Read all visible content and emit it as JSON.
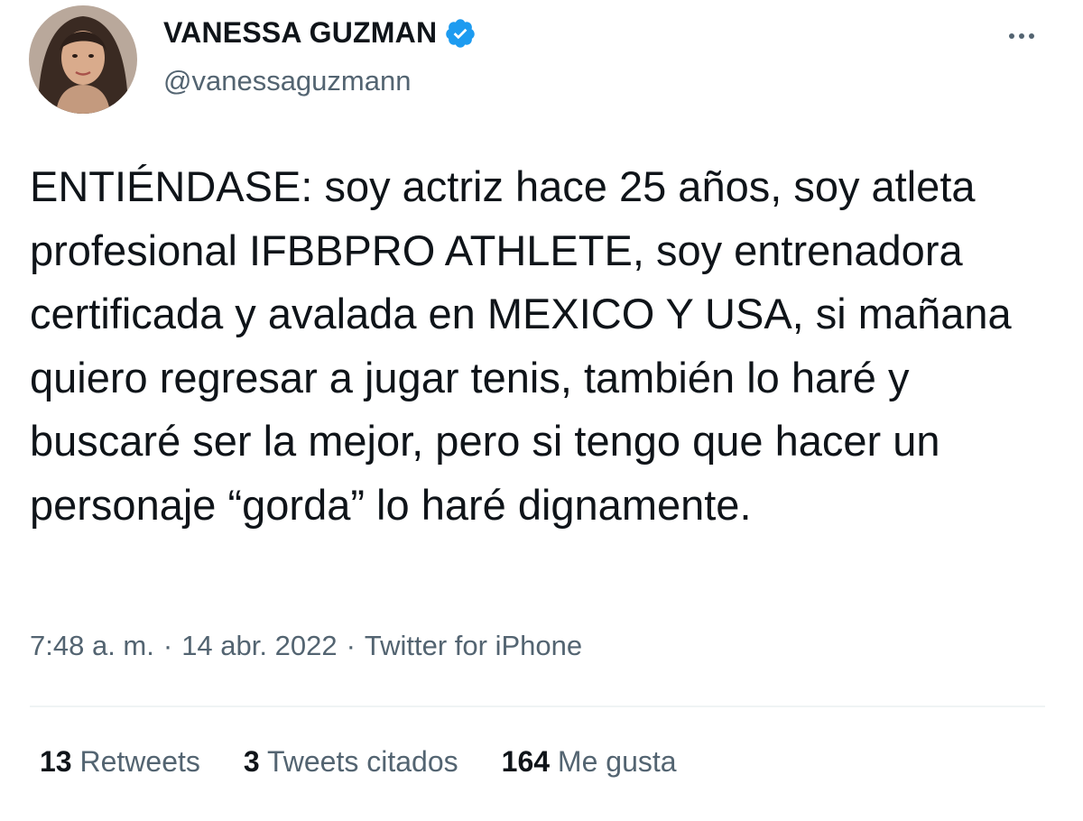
{
  "header": {
    "display_name": "VANESSA GUZMAN",
    "handle": "@vanessaguzmann",
    "avatar_icon": "profile-photo",
    "verified_icon": "verified-badge-icon",
    "more_icon": "more-options-icon"
  },
  "tweet": {
    "text": "ENTIÉNDASE: soy actriz hace 25 años, soy atleta profesional IFBBPRO ATHLETE, soy entrenadora certificada y avalada en MEXICO Y USA, si mañana quiero regresar a jugar tenis, también lo haré y buscaré ser la mejor, pero si tengo que hacer un personaje “gorda” lo haré dignamente.",
    "time": "7:48 a. m.",
    "date": "14 abr. 2022",
    "separator": "·",
    "source": "Twitter for iPhone"
  },
  "stats": {
    "retweets_count": "13",
    "retweets_label": "Retweets",
    "quotes_count": "3",
    "quotes_label": "Tweets citados",
    "likes_count": "164",
    "likes_label": "Me gusta"
  },
  "colors": {
    "text_primary": "#0f1419",
    "text_secondary": "#536471",
    "verified_blue": "#1d9bf0",
    "divider": "#eff3f4"
  }
}
